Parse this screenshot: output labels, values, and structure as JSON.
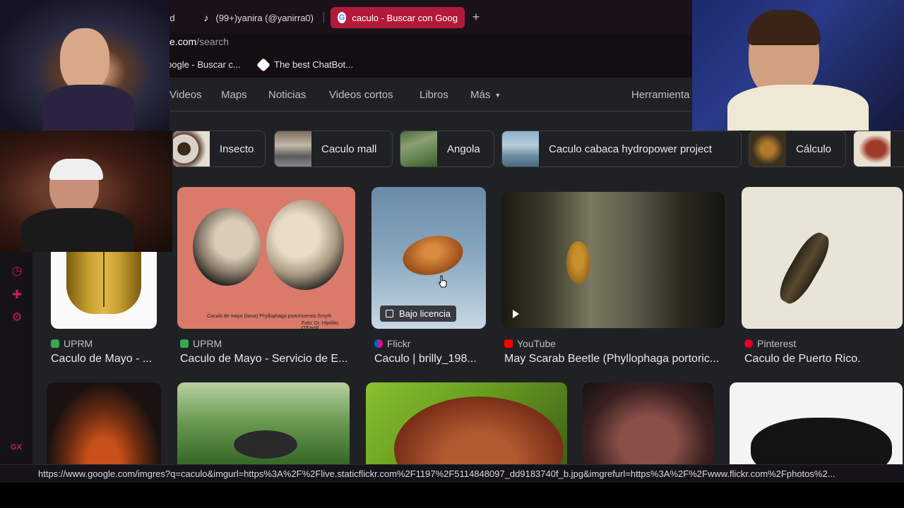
{
  "browser": {
    "tabs": [
      {
        "label": "rd"
      },
      {
        "label": "(99+)yanira (@yanirra0)"
      },
      {
        "label": "caculo - Buscar con Goog"
      }
    ],
    "new_tab": "+",
    "address": {
      "host": "e.com",
      "path": "/search"
    },
    "bookmarks": [
      {
        "label": "oogle - Buscar c..."
      },
      {
        "label": "The best ChatBot..."
      }
    ]
  },
  "nav": {
    "items": [
      "Videos",
      "Maps",
      "Noticias",
      "Videos cortos",
      "Libros",
      "Más"
    ],
    "tools": "Herramienta"
  },
  "chips": [
    "Insecto",
    "Caculo mall",
    "Angola",
    "Caculo cabaca hydropower project",
    "Cálculo"
  ],
  "results_row1": [
    {
      "source": "UPRM",
      "title": "Caculo de Mayo - ...",
      "color": "#34a853"
    },
    {
      "source": "UPRM",
      "title": "Caculo de Mayo - Servicio de E...",
      "color": "#34a853",
      "caption": "Caculo de mayo (larva) Phyllophaga portoricensis Smyth",
      "credit": "Foto: Dr. Hipólito O'Farrill"
    },
    {
      "source": "Flickr",
      "title": "Caculo | brilly_198...",
      "color": "#0063dc",
      "badge": "Bajo licencia"
    },
    {
      "source": "YouTube",
      "title": "May Scarab Beetle (Phyllophaga portoric...",
      "color": "#ff0000"
    },
    {
      "source": "Pinterest",
      "title": "Caculo de Puerto Rico.",
      "color": "#e60023"
    }
  ],
  "sidebar": {
    "label": "GX",
    "more": "•••"
  },
  "status": {
    "url": "https://www.google.com/imgres?q=caculo&imgurl=https%3A%2F%2Flive.staticflickr.com%2F1197%2F5114848097_dd9183740f_b.jpg&imgrefurl=https%3A%2F%2Fwww.flickr.com%2Fphotos%2..."
  }
}
